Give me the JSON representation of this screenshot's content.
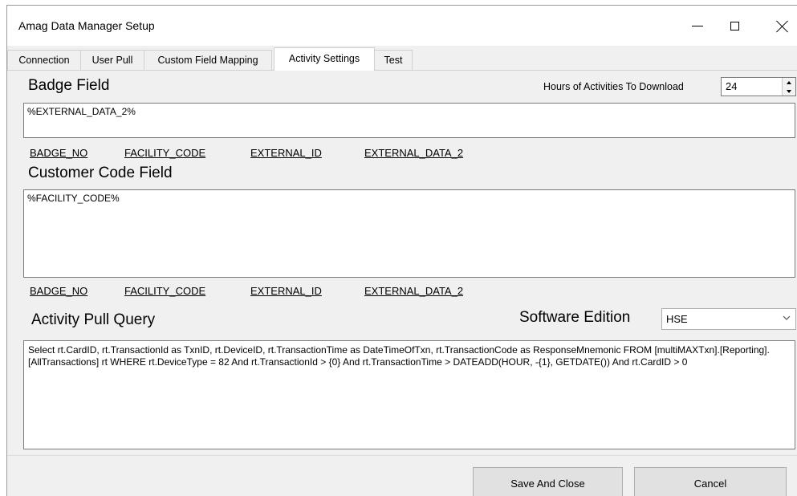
{
  "window": {
    "title": "Amag Data Manager Setup"
  },
  "tabs": [
    {
      "label": "Connection"
    },
    {
      "label": "User Pull"
    },
    {
      "label": "Custom Field Mapping"
    },
    {
      "label": "Activity Settings",
      "active": true
    },
    {
      "label": "Test"
    }
  ],
  "badge_field": {
    "heading": "Badge Field",
    "value": "%EXTERNAL_DATA_2%",
    "tokens": [
      "BADGE_NO",
      "FACILITY_CODE",
      "EXTERNAL_ID",
      "EXTERNAL_DATA_2"
    ]
  },
  "hours": {
    "label": "Hours of Activities To Download",
    "value": "24"
  },
  "customer_code_field": {
    "heading": "Customer Code Field",
    "value": "%FACILITY_CODE%",
    "tokens": [
      "BADGE_NO",
      "FACILITY_CODE",
      "EXTERNAL_ID",
      "EXTERNAL_DATA_2"
    ]
  },
  "activity_query": {
    "heading": "Activity Pull Query",
    "value": "Select rt.CardID, rt.TransactionId as TxnID, rt.DeviceID, rt.TransactionTime as DateTimeOfTxn, rt.TransactionCode as ResponseMnemonic FROM [multiMAXTxn].[Reporting].[AllTransactions] rt WHERE rt.DeviceType = 82 And rt.TransactionId > {0} And rt.TransactionTime > DATEADD(HOUR, -{1}, GETDATE()) And rt.CardID > 0"
  },
  "software_edition": {
    "label": "Software Edition",
    "selected": "HSE"
  },
  "buttons": {
    "save": "Save And Close",
    "cancel": "Cancel"
  }
}
